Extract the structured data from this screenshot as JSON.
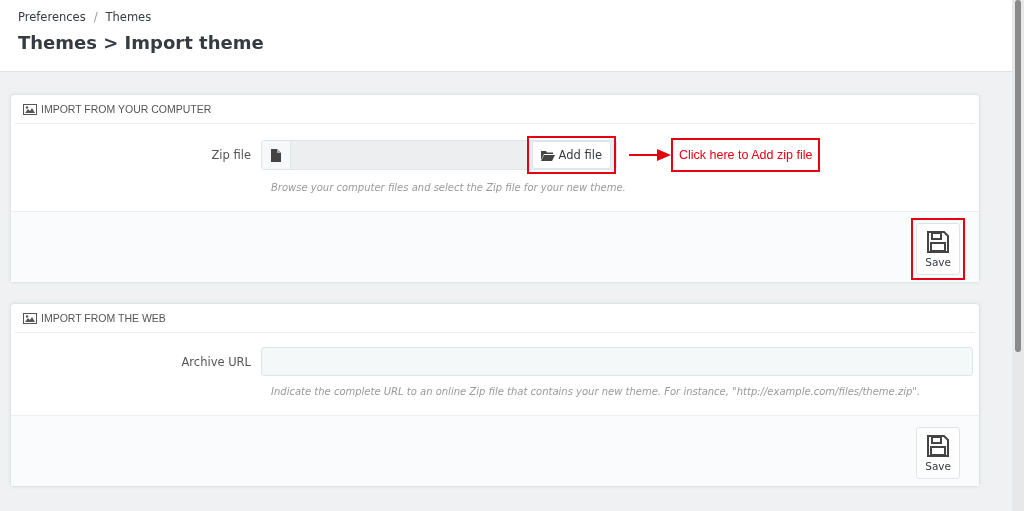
{
  "breadcrumb": [
    "Preferences",
    "Themes"
  ],
  "breadcrumb_separator": "/",
  "title": "Themes > Import theme",
  "panels": [
    {
      "heading": "IMPORT FROM YOUR COMPUTER",
      "field": {
        "kind": "file",
        "label": "Zip file",
        "button": "Add file",
        "button_highlighted": true,
        "help": "Browse your computer files and select the Zip file for your new theme.",
        "callout": "Click here to Add zip file"
      },
      "save": {
        "label": "Save",
        "highlighted": true
      }
    },
    {
      "heading": "IMPORT FROM THE WEB",
      "field": {
        "kind": "text",
        "label": "Archive URL",
        "help": "Indicate the complete URL to an online Zip file that contains your new theme. For instance, \"http://example.com/files/theme.zip\"."
      },
      "save": {
        "label": "Save",
        "highlighted": false
      }
    }
  ]
}
